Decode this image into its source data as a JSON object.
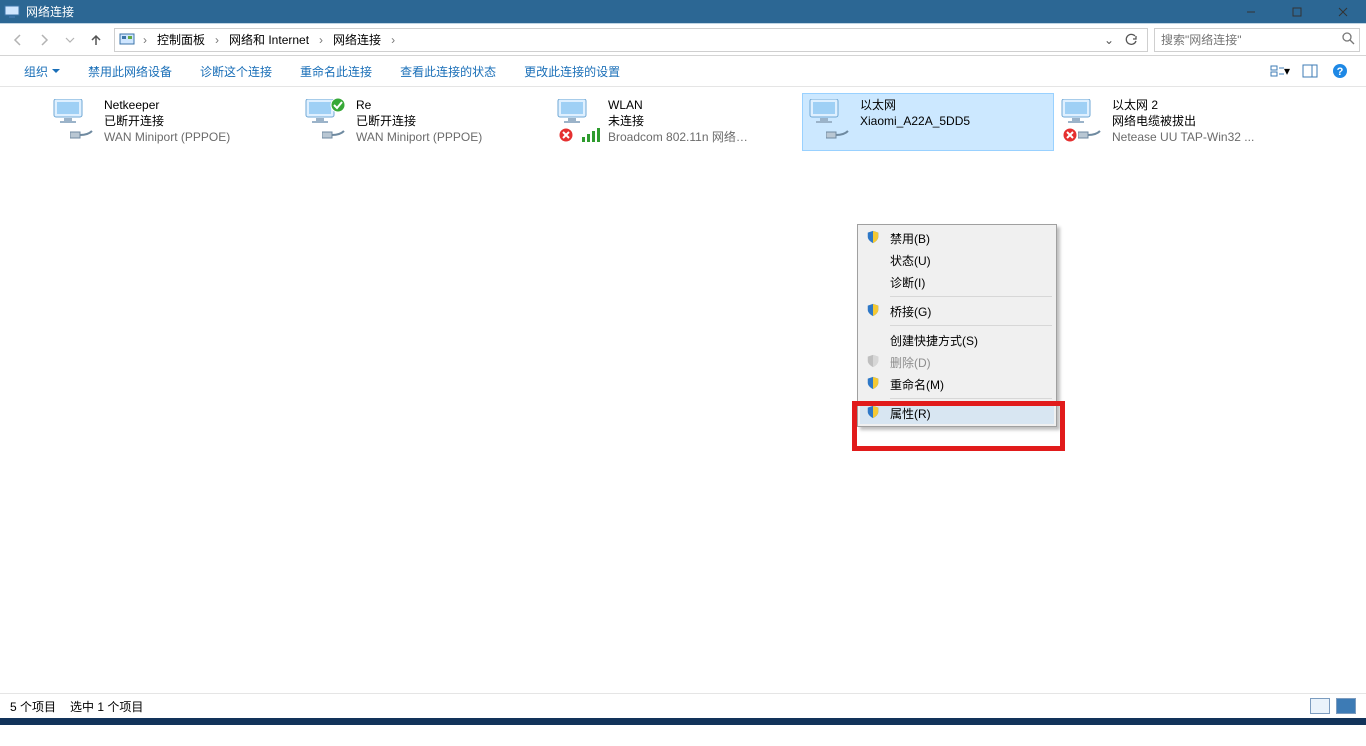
{
  "window": {
    "title": "网络连接"
  },
  "breadcrumb": {
    "root_icon": "control-panel",
    "items": [
      "控制面板",
      "网络和 Internet",
      "网络连接"
    ]
  },
  "search": {
    "placeholder": "搜索\"网络连接\""
  },
  "toolbar": {
    "organize": "组织",
    "actions": [
      "禁用此网络设备",
      "诊断这个连接",
      "重命名此连接",
      "查看此连接的状态",
      "更改此连接的设置"
    ]
  },
  "connections": [
    {
      "name": "Netkeeper",
      "status": "已断开连接",
      "device": "WAN Miniport (PPPOE)",
      "icon": "dialup",
      "overlay": null,
      "selected": false
    },
    {
      "name": "Re",
      "status": "已断开连接",
      "device": "WAN Miniport (PPPOE)",
      "icon": "dialup",
      "overlay": "check",
      "selected": false
    },
    {
      "name": "WLAN",
      "status": "未连接",
      "device": "Broadcom 802.11n 网络…",
      "icon": "wlan",
      "overlay": "error",
      "selected": false
    },
    {
      "name": "以太网",
      "status": "Xiaomi_A22A_5DD5",
      "device": "",
      "icon": "ethernet",
      "overlay": null,
      "selected": true
    },
    {
      "name": "以太网 2",
      "status": "网络电缆被拔出",
      "device": "Netease UU TAP-Win32 ...",
      "icon": "ethernet",
      "overlay": "error",
      "selected": false
    }
  ],
  "context_menu": {
    "items": [
      {
        "label": "禁用(B)",
        "shield": true,
        "disabled": false
      },
      {
        "label": "状态(U)",
        "shield": false,
        "disabled": false
      },
      {
        "label": "诊断(I)",
        "shield": false,
        "disabled": false
      },
      {
        "sep": true
      },
      {
        "label": "桥接(G)",
        "shield": true,
        "disabled": false
      },
      {
        "sep": true
      },
      {
        "label": "创建快捷方式(S)",
        "shield": false,
        "disabled": false
      },
      {
        "label": "删除(D)",
        "shield": true,
        "disabled": true
      },
      {
        "label": "重命名(M)",
        "shield": true,
        "disabled": false
      },
      {
        "sep": true
      },
      {
        "label": "属性(R)",
        "shield": true,
        "disabled": false,
        "hover": true
      }
    ]
  },
  "statusbar": {
    "count": "5 个项目",
    "selected": "选中 1 个项目"
  }
}
